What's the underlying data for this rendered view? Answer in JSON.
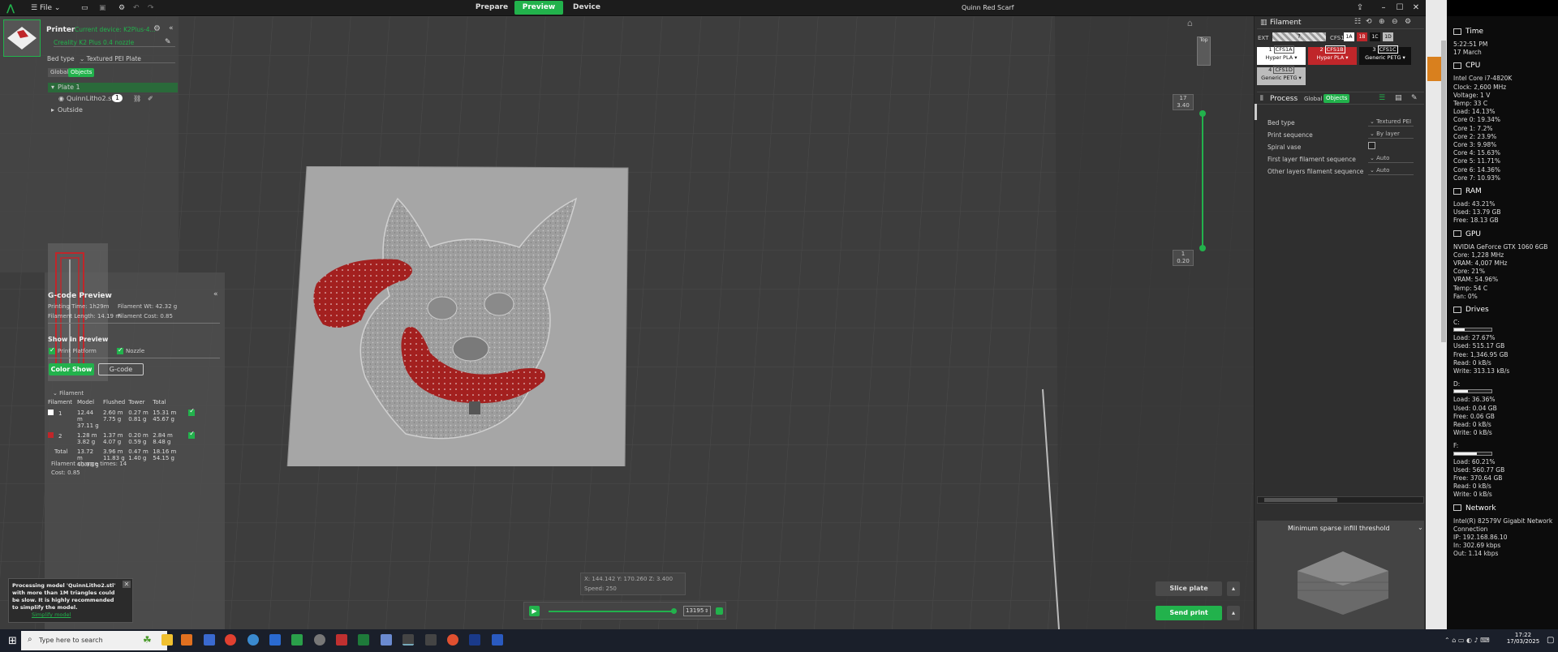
{
  "titlebar": {
    "file_menu": "File",
    "tabs": [
      "Prepare",
      "Preview",
      "Device"
    ],
    "active_tab": "Preview",
    "project_title": "Quinn Red Scarf"
  },
  "printer_panel": {
    "title": "Printer",
    "current_device": "Current device: K2Plus-4...",
    "printer_name": "Creality K2 Plus 0.4 nozzle",
    "bed_type_label": "Bed type",
    "bed_type_value": "Textured PEI Plate",
    "toggle_global": "Global",
    "toggle_objects": "Objects",
    "tree": {
      "plate": "Plate 1",
      "object": "QuinnLitho2.stl",
      "object_count": "1",
      "outside": "Outside"
    }
  },
  "gcode_preview": {
    "title": "G-code Preview",
    "printing_time": "Printing Time: 1h29m",
    "filament_wt": "Filament Wt: 42.32 g",
    "filament_length": "Filament Length: 14.19 m",
    "filament_cost": "Filament Cost: 0.85",
    "show_in_preview": "Show in Preview",
    "print_platform": "Print Platform",
    "nozzle": "Nozzle",
    "color_show_btn": "Color Show",
    "gcode_btn": "G-code",
    "filament_section": "Filament",
    "table_headers": [
      "Filament",
      "Model",
      "Flushed",
      "Tower",
      "Total"
    ],
    "rows": [
      {
        "id": "1",
        "color": "#ffffff",
        "model": [
          "12.44 m",
          "37.11 g"
        ],
        "flushed": [
          "2.60 m",
          "7.75 g"
        ],
        "tower": [
          "0.27 m",
          "0.81 g"
        ],
        "total": [
          "15.31 m",
          "45.67 g"
        ]
      },
      {
        "id": "2",
        "color": "#c0262a",
        "model": [
          "1.28 m",
          "3.82 g"
        ],
        "flushed": [
          "1.37 m",
          "4.07 g"
        ],
        "tower": [
          "0.20 m",
          "0.59 g"
        ],
        "total": [
          "2.84 m",
          "8.48 g"
        ]
      }
    ],
    "total_row": {
      "label": "Total",
      "model": [
        "13.72 m",
        "40.93 g"
      ],
      "flushed": [
        "3.96 m",
        "11.83 g"
      ],
      "tower": [
        "0.47 m",
        "1.40 g"
      ],
      "total": [
        "18.16 m",
        "54.15 g"
      ]
    },
    "filament_change_times": "Filament change times:  14",
    "cost": "Cost:  0.85"
  },
  "notification": {
    "text": "Processing model 'QuinnLitho2.stl' with more than 1M triangles could be slow. It is highly recommended to simplify the model.",
    "link": "Simplify model"
  },
  "layer_slider": {
    "top_layer": "17",
    "top_height": "3.40",
    "bottom_layer": "1",
    "bottom_height": "0.20"
  },
  "coords": {
    "text": "X: 144.142  Y: 170.260  Z: 3.400",
    "speed": "Speed: 250"
  },
  "playback": {
    "move_value": "13195",
    "progress": 1.0
  },
  "actions": {
    "slice_plate": "Slice plate",
    "send_print": "Send print"
  },
  "filament_panel": {
    "title": "Filament",
    "ext_label": "EXT",
    "ext_slot": "?",
    "cfs_label": "CFS1",
    "cfs_slots": [
      "1A",
      "1B",
      "1C",
      "1D"
    ],
    "slots": [
      {
        "num": "1",
        "tag": "CFS1A",
        "name": "Hyper PLA",
        "bg": "#ffffff",
        "fg": "#111111"
      },
      {
        "num": "2",
        "tag": "CFS1B",
        "name": "Hyper PLA",
        "bg": "#c0262a",
        "fg": "#ffffff"
      },
      {
        "num": "3",
        "tag": "CFS1C",
        "name": "Generic PETG",
        "bg": "#111111",
        "fg": "#ffffff"
      },
      {
        "num": "4",
        "tag": "CFS1D",
        "name": "Generic PETG",
        "bg": "#bbbbbb",
        "fg": "#111111"
      }
    ]
  },
  "process_panel": {
    "title": "Process",
    "toggle_global": "Global",
    "toggle_objects": "Objects",
    "rows": [
      {
        "label": "Bed type",
        "value": "Textured PEI P..."
      },
      {
        "label": "Print sequence",
        "value": "By layer"
      },
      {
        "label": "Spiral vase",
        "value": ""
      },
      {
        "label": "First layer filament sequence",
        "value": "Auto"
      },
      {
        "label": "Other layers filament sequence",
        "value": "Auto"
      }
    ],
    "tip_title": "Minimum sparse infill threshold"
  },
  "monitor": {
    "time_head": "Time",
    "time": "5:22:51 PM",
    "date": "17 March",
    "cpu_head": "CPU",
    "cpu": [
      "Intel Core i7-4820K",
      "Clock: 2,600 MHz",
      "Voltage: 1 V",
      "Temp: 33 C",
      "Load: 14.13%",
      "Core 0: 19.34%",
      "Core 1: 7.2%",
      "Core 2: 23.9%",
      "Core 3: 9.98%",
      "Core 4: 15.63%",
      "Core 5: 11.71%",
      "Core 6: 14.36%",
      "Core 7: 10.93%"
    ],
    "ram_head": "RAM",
    "ram": [
      "Load: 43.21%",
      "Used: 13.79 GB",
      "Free: 18.13 GB"
    ],
    "gpu_head": "GPU",
    "gpu": [
      "NVIDIA GeForce GTX 1060 6GB",
      "Core: 1,228 MHz",
      "VRAM: 4,007 MHz",
      "Core: 21%",
      "VRAM: 54.96%",
      "Temp: 54 C",
      "Fan: 0%"
    ],
    "drives_head": "Drives",
    "drive_c_label": "C:",
    "drive_c_load": 0.2767,
    "drive_c": [
      "Load: 27.67%",
      "Used: 515.17 GB",
      "Free: 1,346.95 GB",
      "Read: 0 kB/s",
      "Write: 313.13 kB/s"
    ],
    "drive_d_label": "D:",
    "drive_d_load": 0.3636,
    "drive_d": [
      "Load: 36.36%",
      "Used: 0.04 GB",
      "Free: 0.06 GB",
      "Read: 0 kB/s",
      "Write: 0 kB/s"
    ],
    "drive_f_label": "F:",
    "drive_f_load": 0.6021,
    "drive_f": [
      "Load: 60.21%",
      "Used: 560.77 GB",
      "Free: 370.64 GB",
      "Read: 0 kB/s",
      "Write: 0 kB/s"
    ],
    "network_head": "Network",
    "network": [
      "Intel(R) 82579V Gigabit Network",
      "Connection",
      "IP: 192.168.86.10",
      "In: 302.69 kbps",
      "Out: 1.14 kbps"
    ]
  },
  "taskbar": {
    "search_placeholder": "Type here to search",
    "clock_time": "17:22",
    "clock_date": "17/03/2025"
  }
}
